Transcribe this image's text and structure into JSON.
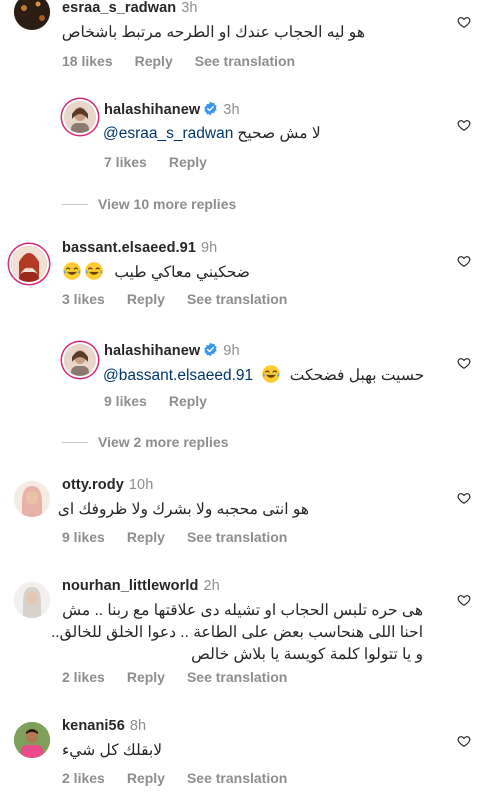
{
  "icons": {
    "heart": "heart-outline-icon",
    "verified": "verified-badge-icon"
  },
  "colors": {
    "link": "#00376b",
    "secondary": "#8e8e8e",
    "verified": "#3897f0"
  },
  "comments": [
    {
      "username": "esraa_s_radwan",
      "time": "3h",
      "text": "هو ليه الحجاب عندك او الطرحه مرتبط باشخاص",
      "likes": "18 likes",
      "reply": "Reply",
      "translate": "See translation"
    },
    {
      "username": "halashihanew",
      "time": "3h",
      "mention": "@esraa_s_radwan",
      "text": "لا مش صحيح",
      "likes": "7 likes",
      "reply": "Reply"
    },
    {
      "view_more": "View 10 more replies"
    },
    {
      "username": "bassant.elsaeed.91",
      "time": "9h",
      "text": "ضحكيني معاكي طيب",
      "likes": "3 likes",
      "reply": "Reply",
      "translate": "See translation"
    },
    {
      "username": "halashihanew",
      "time": "9h",
      "mention": "@bassant.elsaeed.91",
      "text": "حسيت بهبل فضحكت",
      "likes": "9 likes",
      "reply": "Reply"
    },
    {
      "view_more": "View 2 more replies"
    },
    {
      "username": "otty.rody",
      "time": "10h",
      "text": "هو انتى محجبه ولا بشرك ولا ظروفك اى",
      "likes": "9 likes",
      "reply": "Reply",
      "translate": "See translation"
    },
    {
      "username": "nourhan_littleworld",
      "time": "2h",
      "lines": [
        "هى حره تلبس الحجاب او تشيله دى علاقتها مع ربنا .. مش",
        "احنا اللى هنحاسب بعض على الطاعة .. دعوا الخلق للخالق..",
        "و يا تتولوا كلمة كويسة يا بلاش خالص"
      ],
      "likes": "2 likes",
      "reply": "Reply",
      "translate": "See translation"
    },
    {
      "username": "kenani56",
      "time": "8h",
      "text": "لابقلك كل شيء",
      "likes": "2 likes",
      "reply": "Reply",
      "translate": "See translation"
    }
  ]
}
